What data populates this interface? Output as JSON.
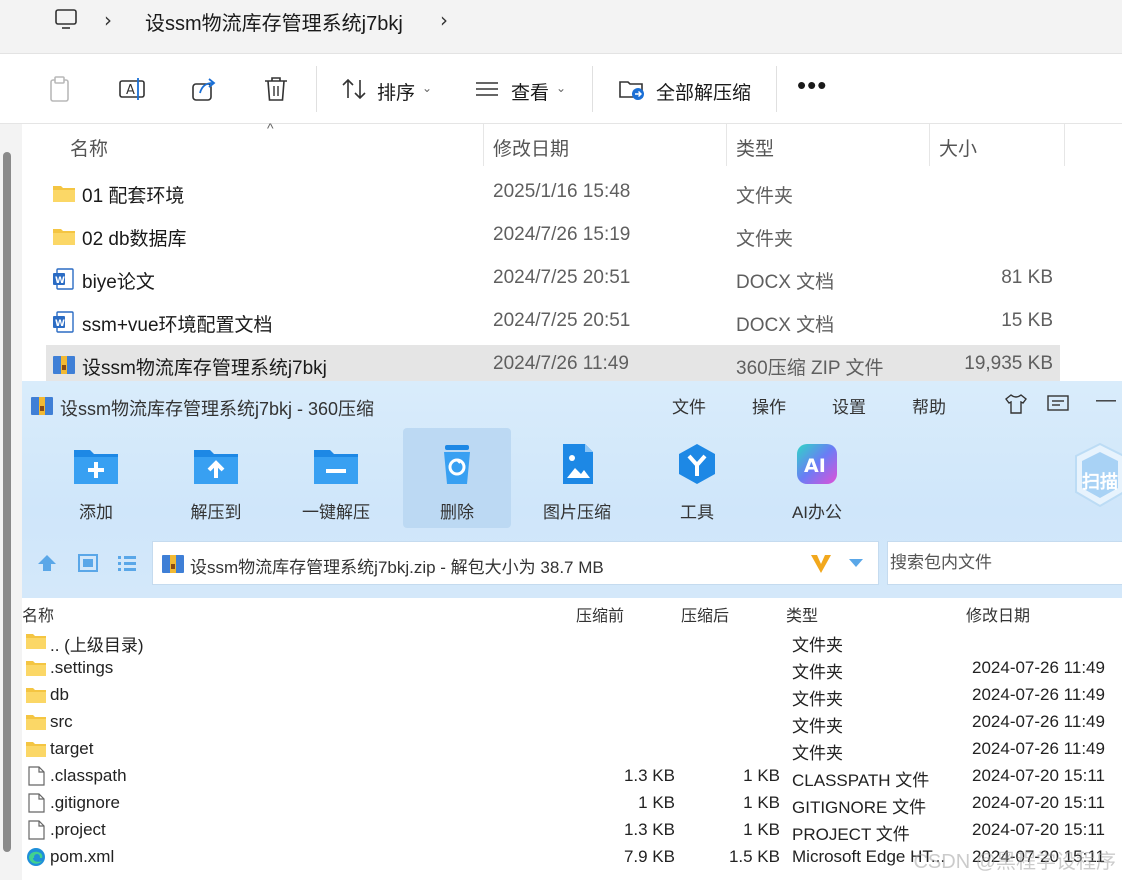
{
  "explorer": {
    "breadcrumb": "设ssm物流库存管理系统j7bkj",
    "toolbar": {
      "sort_label": "排序",
      "view_label": "查看",
      "extract_all_label": "全部解压缩"
    },
    "columns": {
      "name": "名称",
      "modified": "修改日期",
      "type": "类型",
      "size": "大小"
    },
    "rows": [
      {
        "name": "01 配套环境",
        "modified": "2025/1/16 15:48",
        "type": "文件夹",
        "size": "",
        "icon": "folder-icon"
      },
      {
        "name": "02 db数据库",
        "modified": "2024/7/26 15:19",
        "type": "文件夹",
        "size": "",
        "icon": "folder-icon"
      },
      {
        "name": "biye论文",
        "modified": "2024/7/25 20:51",
        "type": "DOCX 文档",
        "size": "81 KB",
        "icon": "word-doc-icon"
      },
      {
        "name": "ssm+vue环境配置文档",
        "modified": "2024/7/25 20:51",
        "type": "DOCX 文档",
        "size": "15 KB",
        "icon": "word-doc-icon"
      },
      {
        "name": "设ssm物流库存管理系统j7bkj",
        "modified": "2024/7/26 11:49",
        "type": "360压缩 ZIP 文件",
        "size": "19,935 KB",
        "icon": "zip-archive-icon"
      }
    ]
  },
  "archiver": {
    "title": "设ssm物流库存管理系统j7bkj - 360压缩",
    "menu": {
      "file": "文件",
      "operate": "操作",
      "settings": "设置",
      "help": "帮助"
    },
    "tools": {
      "add": "添加",
      "extract_to": "解压到",
      "one_click": "一键解压",
      "delete": "删除",
      "image_compress": "图片压缩",
      "tools": "工具",
      "ai_office": "AI办公",
      "scan": "扫描"
    },
    "path_text": "设ssm物流库存管理系统j7bkj.zip - 解包大小为 38.7 MB",
    "search_placeholder": "搜索包内文件",
    "columns": {
      "name": "名称",
      "before": "压缩前",
      "after": "压缩后",
      "type": "类型",
      "modified": "修改日期"
    },
    "rows": [
      {
        "name": ".. (上级目录)",
        "before": "",
        "after": "",
        "type": "文件夹",
        "modified": "",
        "icon": "folder-icon"
      },
      {
        "name": ".settings",
        "before": "",
        "after": "",
        "type": "文件夹",
        "modified": "2024-07-26 11:49",
        "icon": "folder-icon"
      },
      {
        "name": "db",
        "before": "",
        "after": "",
        "type": "文件夹",
        "modified": "2024-07-26 11:49",
        "icon": "folder-icon"
      },
      {
        "name": "src",
        "before": "",
        "after": "",
        "type": "文件夹",
        "modified": "2024-07-26 11:49",
        "icon": "folder-icon"
      },
      {
        "name": "target",
        "before": "",
        "after": "",
        "type": "文件夹",
        "modified": "2024-07-26 11:49",
        "icon": "folder-icon"
      },
      {
        "name": ".classpath",
        "before": "1.3 KB",
        "after": "1 KB",
        "type": "CLASSPATH 文件",
        "modified": "2024-07-20 15:11",
        "icon": "file-icon"
      },
      {
        "name": ".gitignore",
        "before": "1 KB",
        "after": "1 KB",
        "type": "GITIGNORE 文件",
        "modified": "2024-07-20 15:11",
        "icon": "file-icon"
      },
      {
        "name": ".project",
        "before": "1.3 KB",
        "after": "1 KB",
        "type": "PROJECT 文件",
        "modified": "2024-07-20 15:11",
        "icon": "file-icon"
      },
      {
        "name": "pom.xml",
        "before": "7.9 KB",
        "after": "1.5 KB",
        "type": "Microsoft Edge HT...",
        "modified": "2024-07-20 15:11",
        "icon": "edge-icon"
      }
    ]
  },
  "watermark": "CSDN @黑程学设程序"
}
